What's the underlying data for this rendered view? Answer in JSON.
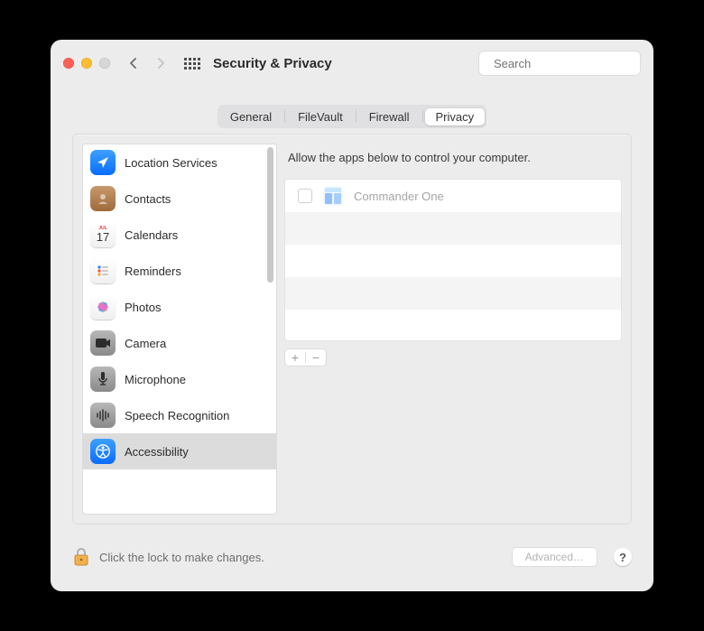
{
  "window": {
    "title": "Security & Privacy"
  },
  "search": {
    "placeholder": "Search"
  },
  "tabs": {
    "general": "General",
    "filevault": "FileVault",
    "firewall": "Firewall",
    "privacy": "Privacy"
  },
  "sidebar": {
    "items": [
      {
        "label": "Location Services"
      },
      {
        "label": "Contacts"
      },
      {
        "label": "Calendars"
      },
      {
        "label": "Reminders"
      },
      {
        "label": "Photos"
      },
      {
        "label": "Camera"
      },
      {
        "label": "Microphone"
      },
      {
        "label": "Speech Recognition"
      },
      {
        "label": "Accessibility"
      }
    ],
    "calendar_badge": {
      "month": "JUL",
      "day": "17"
    }
  },
  "content": {
    "hint": "Allow the apps below to control your computer.",
    "apps": [
      {
        "name": "Commander One",
        "checked": false
      }
    ]
  },
  "footer": {
    "lock_text": "Click the lock to make changes.",
    "advanced": "Advanced…",
    "help": "?"
  }
}
